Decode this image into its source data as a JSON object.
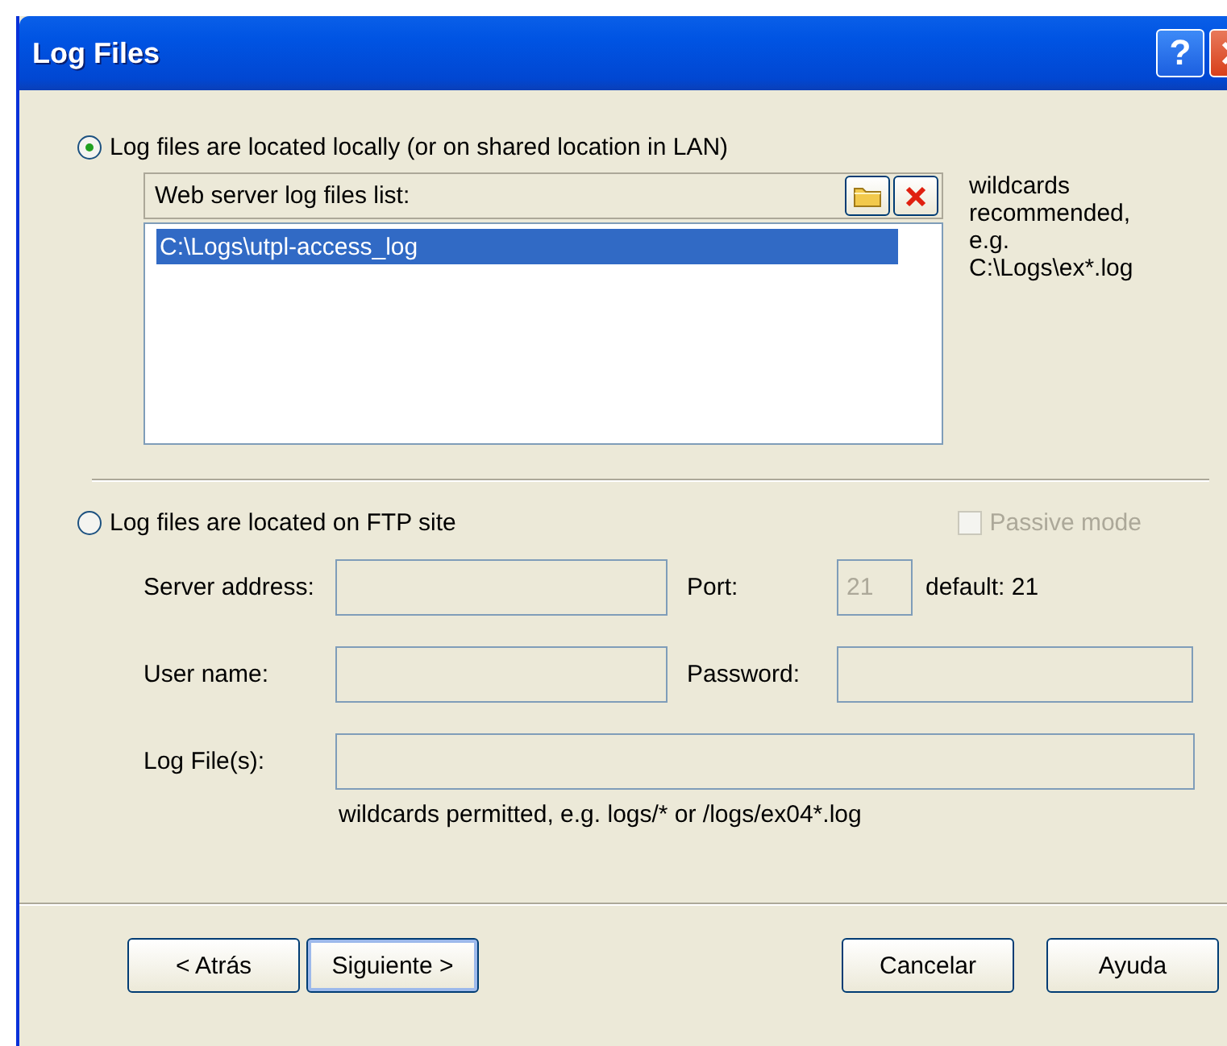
{
  "window": {
    "title": "Log Files",
    "help_button": "?"
  },
  "local_option": {
    "label": "Log files are located locally (or on shared location in LAN)",
    "selected": true
  },
  "file_list": {
    "header": "Web server log files list:",
    "items": [
      {
        "path": "C:\\Logs\\utpl-access_log",
        "selected": true
      }
    ]
  },
  "list_hint": "wildcards\nrecommended,\n e.g.\nC:\\Logs\\ex*.log",
  "ftp_option": {
    "label": "Log files are located on FTP site",
    "selected": false
  },
  "passive_mode": {
    "label": "Passive mode",
    "checked": false,
    "disabled": true
  },
  "ftp_fields": {
    "disabled": true,
    "server_label": "Server address:",
    "port_label": "Port:",
    "port_value": "21",
    "port_default": "default: 21",
    "user_label": "User name:",
    "password_label": "Password:",
    "log_label": "Log File(s):",
    "log_hint": "wildcards permitted, e.g. logs/* or /logs/ex04*.log"
  },
  "buttons": [
    {
      "label": "< Atrás",
      "default": false
    },
    {
      "label": "Siguiente >",
      "default": true
    },
    {
      "label": "Cancelar",
      "default": false
    },
    {
      "label": "Ayuda",
      "default": false
    }
  ]
}
